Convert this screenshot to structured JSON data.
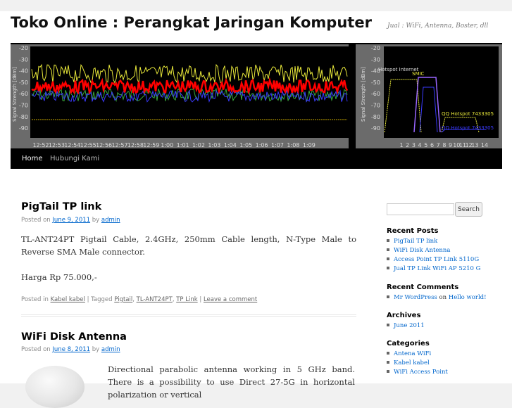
{
  "header": {
    "title": "Toko Online : Perangkat Jaringan Komputer",
    "description": "Jual : WiFi, Antenna, Boster, dll"
  },
  "banner": {
    "left_y_axis_label": "Signal Strength [dBm]",
    "right_y_axis_label": "Signal Strength [dBm]",
    "y_ticks": [
      "-20",
      "-30",
      "-40",
      "-50",
      "-60",
      "-70",
      "-80",
      "-90"
    ],
    "time_ticks": [
      "12:52",
      "12:53",
      "12:54",
      "12:55",
      "12:56",
      "12:57",
      "12:58",
      "12:59",
      "1:00",
      "1:01",
      "1:02",
      "1:03",
      "1:04",
      "1:05",
      "1:06",
      "1:07",
      "1:08",
      "1:09"
    ],
    "channel_ticks": [
      "1",
      "2",
      "3",
      "4",
      "5",
      "6",
      "7",
      "8",
      "9",
      "10",
      "11",
      "12",
      "13",
      "14"
    ],
    "network_labels": [
      "Hotspot Internet",
      "SMIC",
      "QQ Hotspot 7433305",
      "QQ Hotspot 7433305"
    ],
    "colors": {
      "yellow": "#e8e83a",
      "red": "#ff0000",
      "green": "#3aa83a",
      "blue": "#3a3aff",
      "purple": "#9966ff"
    }
  },
  "nav": {
    "items": [
      {
        "label": "Home",
        "current": true
      },
      {
        "label": "Hubungi Kami",
        "current": false
      }
    ]
  },
  "posts": [
    {
      "title": "PigTail TP link",
      "posted_on": "Posted on",
      "date": "June 9, 2011",
      "by": "by",
      "author": "admin",
      "paragraphs": [
        "TL-ANT24PT Pigtail Cable, 2.4GHz, 250mm Cable length, N-Type Male to Reverse SMA Male connector.",
        "Harga Rp 75.000,-"
      ],
      "posted_in": "Posted in",
      "category": "Kabel kabel",
      "tagged": "| Tagged",
      "tags": [
        "Pigtail",
        "TL-ANT24PT",
        "TP Link"
      ],
      "leave_comment": "Leave a comment"
    },
    {
      "title": "WiFi Disk Antenna",
      "posted_on": "Posted on",
      "date": "June 8, 2011",
      "by": "by",
      "author": "admin",
      "excerpt": "Directional parabolic antenna working in 5 GHz band. There is a possibility to use Direct 27-5G in horizontal polarization or vertical"
    }
  ],
  "sidebar": {
    "search_placeholder": "",
    "search_button": "Search",
    "recent_posts_title": "Recent Posts",
    "recent_posts": [
      "PigTail TP link",
      "WiFi Disk Antenna",
      "Access Point TP Link 5110G",
      "Jual TP Link WiFi AP 5210 G"
    ],
    "recent_comments_title": "Recent Comments",
    "recent_comment": {
      "author": "Mr WordPress",
      "on": "on",
      "post": "Hello world!"
    },
    "archives_title": "Archives",
    "archives": [
      "June 2011"
    ],
    "categories_title": "Categories",
    "categories": [
      "Antena WiFi",
      "Kabel kabel",
      "WiFi Access Point"
    ]
  }
}
